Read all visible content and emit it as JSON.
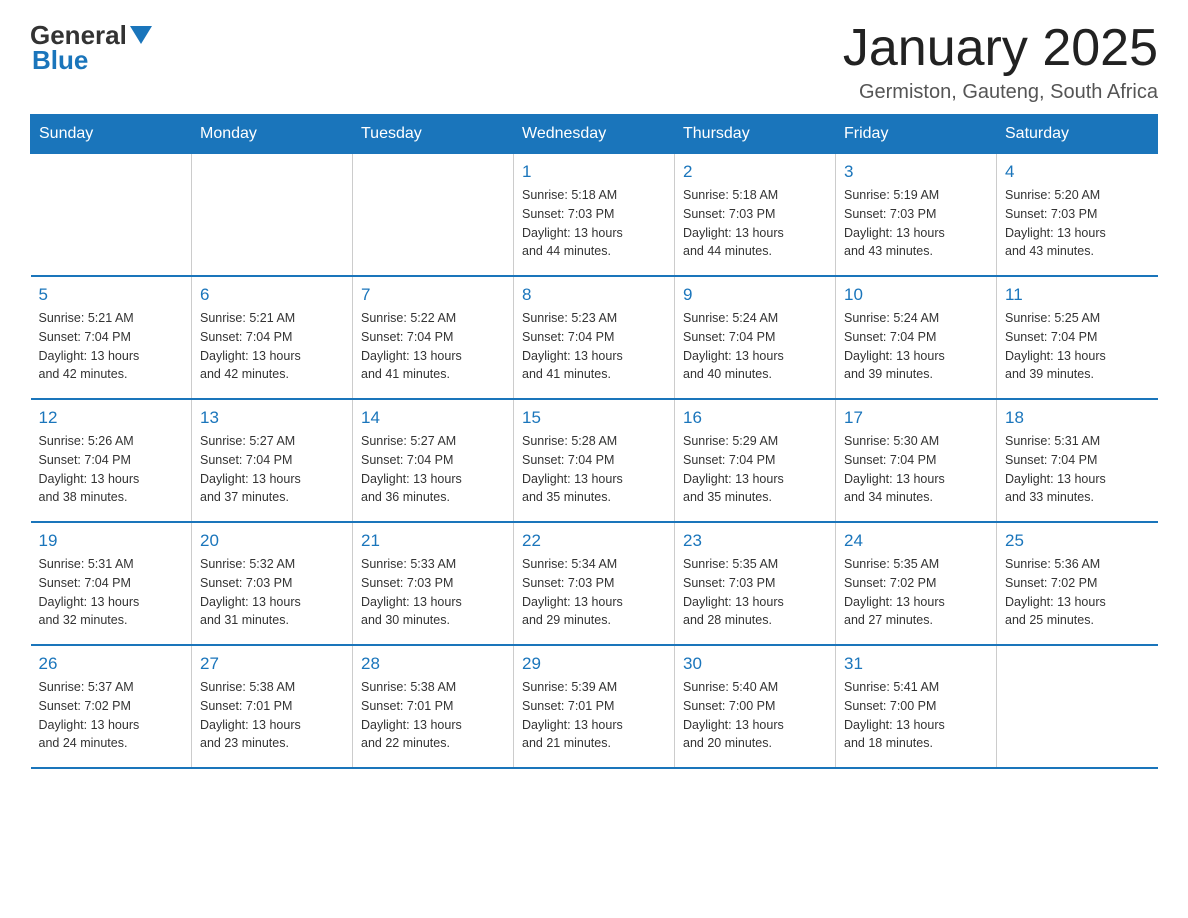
{
  "header": {
    "logo": {
      "general": "General",
      "blue": "Blue"
    },
    "title": "January 2025",
    "subtitle": "Germiston, Gauteng, South Africa"
  },
  "calendar": {
    "days_of_week": [
      "Sunday",
      "Monday",
      "Tuesday",
      "Wednesday",
      "Thursday",
      "Friday",
      "Saturday"
    ],
    "weeks": [
      [
        {
          "day": "",
          "info": ""
        },
        {
          "day": "",
          "info": ""
        },
        {
          "day": "",
          "info": ""
        },
        {
          "day": "1",
          "info": "Sunrise: 5:18 AM\nSunset: 7:03 PM\nDaylight: 13 hours\nand 44 minutes."
        },
        {
          "day": "2",
          "info": "Sunrise: 5:18 AM\nSunset: 7:03 PM\nDaylight: 13 hours\nand 44 minutes."
        },
        {
          "day": "3",
          "info": "Sunrise: 5:19 AM\nSunset: 7:03 PM\nDaylight: 13 hours\nand 43 minutes."
        },
        {
          "day": "4",
          "info": "Sunrise: 5:20 AM\nSunset: 7:03 PM\nDaylight: 13 hours\nand 43 minutes."
        }
      ],
      [
        {
          "day": "5",
          "info": "Sunrise: 5:21 AM\nSunset: 7:04 PM\nDaylight: 13 hours\nand 42 minutes."
        },
        {
          "day": "6",
          "info": "Sunrise: 5:21 AM\nSunset: 7:04 PM\nDaylight: 13 hours\nand 42 minutes."
        },
        {
          "day": "7",
          "info": "Sunrise: 5:22 AM\nSunset: 7:04 PM\nDaylight: 13 hours\nand 41 minutes."
        },
        {
          "day": "8",
          "info": "Sunrise: 5:23 AM\nSunset: 7:04 PM\nDaylight: 13 hours\nand 41 minutes."
        },
        {
          "day": "9",
          "info": "Sunrise: 5:24 AM\nSunset: 7:04 PM\nDaylight: 13 hours\nand 40 minutes."
        },
        {
          "day": "10",
          "info": "Sunrise: 5:24 AM\nSunset: 7:04 PM\nDaylight: 13 hours\nand 39 minutes."
        },
        {
          "day": "11",
          "info": "Sunrise: 5:25 AM\nSunset: 7:04 PM\nDaylight: 13 hours\nand 39 minutes."
        }
      ],
      [
        {
          "day": "12",
          "info": "Sunrise: 5:26 AM\nSunset: 7:04 PM\nDaylight: 13 hours\nand 38 minutes."
        },
        {
          "day": "13",
          "info": "Sunrise: 5:27 AM\nSunset: 7:04 PM\nDaylight: 13 hours\nand 37 minutes."
        },
        {
          "day": "14",
          "info": "Sunrise: 5:27 AM\nSunset: 7:04 PM\nDaylight: 13 hours\nand 36 minutes."
        },
        {
          "day": "15",
          "info": "Sunrise: 5:28 AM\nSunset: 7:04 PM\nDaylight: 13 hours\nand 35 minutes."
        },
        {
          "day": "16",
          "info": "Sunrise: 5:29 AM\nSunset: 7:04 PM\nDaylight: 13 hours\nand 35 minutes."
        },
        {
          "day": "17",
          "info": "Sunrise: 5:30 AM\nSunset: 7:04 PM\nDaylight: 13 hours\nand 34 minutes."
        },
        {
          "day": "18",
          "info": "Sunrise: 5:31 AM\nSunset: 7:04 PM\nDaylight: 13 hours\nand 33 minutes."
        }
      ],
      [
        {
          "day": "19",
          "info": "Sunrise: 5:31 AM\nSunset: 7:04 PM\nDaylight: 13 hours\nand 32 minutes."
        },
        {
          "day": "20",
          "info": "Sunrise: 5:32 AM\nSunset: 7:03 PM\nDaylight: 13 hours\nand 31 minutes."
        },
        {
          "day": "21",
          "info": "Sunrise: 5:33 AM\nSunset: 7:03 PM\nDaylight: 13 hours\nand 30 minutes."
        },
        {
          "day": "22",
          "info": "Sunrise: 5:34 AM\nSunset: 7:03 PM\nDaylight: 13 hours\nand 29 minutes."
        },
        {
          "day": "23",
          "info": "Sunrise: 5:35 AM\nSunset: 7:03 PM\nDaylight: 13 hours\nand 28 minutes."
        },
        {
          "day": "24",
          "info": "Sunrise: 5:35 AM\nSunset: 7:02 PM\nDaylight: 13 hours\nand 27 minutes."
        },
        {
          "day": "25",
          "info": "Sunrise: 5:36 AM\nSunset: 7:02 PM\nDaylight: 13 hours\nand 25 minutes."
        }
      ],
      [
        {
          "day": "26",
          "info": "Sunrise: 5:37 AM\nSunset: 7:02 PM\nDaylight: 13 hours\nand 24 minutes."
        },
        {
          "day": "27",
          "info": "Sunrise: 5:38 AM\nSunset: 7:01 PM\nDaylight: 13 hours\nand 23 minutes."
        },
        {
          "day": "28",
          "info": "Sunrise: 5:38 AM\nSunset: 7:01 PM\nDaylight: 13 hours\nand 22 minutes."
        },
        {
          "day": "29",
          "info": "Sunrise: 5:39 AM\nSunset: 7:01 PM\nDaylight: 13 hours\nand 21 minutes."
        },
        {
          "day": "30",
          "info": "Sunrise: 5:40 AM\nSunset: 7:00 PM\nDaylight: 13 hours\nand 20 minutes."
        },
        {
          "day": "31",
          "info": "Sunrise: 5:41 AM\nSunset: 7:00 PM\nDaylight: 13 hours\nand 18 minutes."
        },
        {
          "day": "",
          "info": ""
        }
      ]
    ]
  }
}
